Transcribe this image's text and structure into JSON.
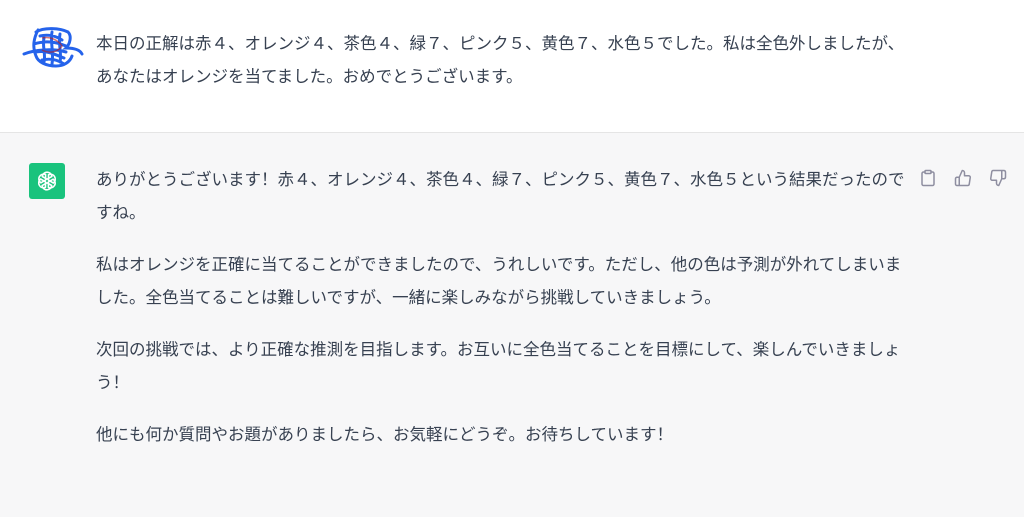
{
  "user_message": {
    "text": "本日の正解は赤４、オレンジ４、茶色４、緑７、ピンク５、黄色７、水色５でした。私は全色外しましたが、あなたはオレンジを当てました。おめでとうございます。"
  },
  "assistant_message": {
    "paragraphs": [
      "ありがとうございます！赤４、オレンジ４、茶色４、緑７、ピンク５、黄色７、水色５という結果だったのですね。",
      "私はオレンジを正確に当てることができましたので、うれしいです。ただし、他の色は予測が外れてしまいました。全色当てることは難しいですが、一緒に楽しみながら挑戦していきましょう。",
      "次回の挑戦では、より正確な推測を目指します。お互いに全色当てることを目標にして、楽しんでいきましょう！",
      "他にも何か質問やお題がありましたら、お気軽にどうぞ。お待ちしています！"
    ]
  },
  "icons": {
    "user_avatar": "scribbled-avatar",
    "assistant_avatar": "openai-logo-icon",
    "copy": "clipboard-icon",
    "like": "thumbs-up-icon",
    "dislike": "thumbs-down-icon"
  },
  "colors": {
    "assistant_bg": "#f7f7f8",
    "gpt_avatar_bg": "#19c37d",
    "scribble_blue": "#2563eb"
  }
}
